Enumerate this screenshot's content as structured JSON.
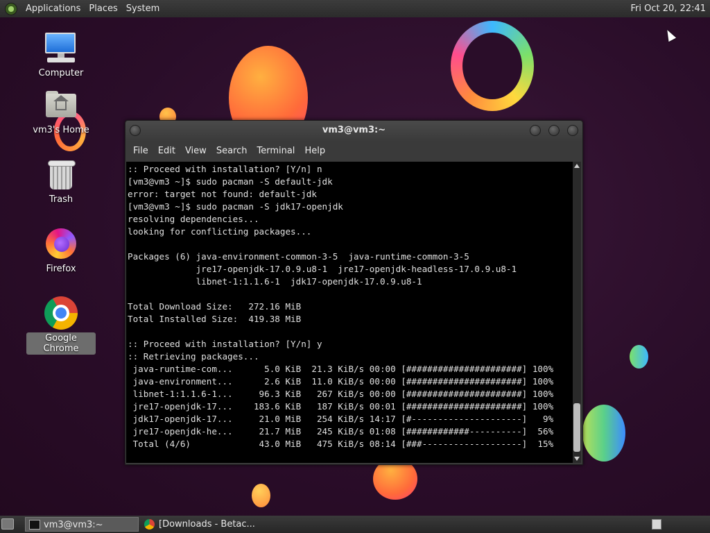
{
  "top_panel": {
    "menus": [
      "Applications",
      "Places",
      "System"
    ],
    "clock": "Fri Oct 20, 22:41"
  },
  "desktop_icons": [
    {
      "label": "Computer",
      "icon": "computer-icon"
    },
    {
      "label": "vm3's Home",
      "icon": "home-folder-icon"
    },
    {
      "label": "Trash",
      "icon": "trash-icon"
    },
    {
      "label": "Firefox",
      "icon": "firefox-icon"
    },
    {
      "label": "Google Chrome",
      "icon": "chrome-icon",
      "selected": true
    }
  ],
  "terminal": {
    "title": "vm3@vm3:~",
    "menus": [
      "File",
      "Edit",
      "View",
      "Search",
      "Terminal",
      "Help"
    ],
    "lines": [
      ":: Proceed with installation? [Y/n] n",
      "[vm3@vm3 ~]$ sudo pacman -S default-jdk",
      "error: target not found: default-jdk",
      "[vm3@vm3 ~]$ sudo pacman -S jdk17-openjdk",
      "resolving dependencies...",
      "looking for conflicting packages...",
      "",
      "Packages (6) java-environment-common-3-5  java-runtime-common-3-5",
      "             jre17-openjdk-17.0.9.u8-1  jre17-openjdk-headless-17.0.9.u8-1",
      "             libnet-1:1.1.6-1  jdk17-openjdk-17.0.9.u8-1",
      "",
      "Total Download Size:   272.16 MiB",
      "Total Installed Size:  419.38 MiB",
      "",
      ":: Proceed with installation? [Y/n] y",
      ":: Retrieving packages...",
      " java-runtime-com...      5.0 KiB  21.3 KiB/s 00:00 [######################] 100%",
      " java-environment...      2.6 KiB  11.0 KiB/s 00:00 [######################] 100%",
      " libnet-1:1.1.6-1...     96.3 KiB   267 KiB/s 00:00 [######################] 100%",
      " jre17-openjdk-17...    183.6 KiB   187 KiB/s 00:01 [######################] 100%",
      " jdk17-openjdk-17...     21.0 MiB   254 KiB/s 14:17 [#---------------------]   9%",
      " jre17-openjdk-he...     21.7 MiB   245 KiB/s 01:08 [############----------]  56%",
      " Total (4/6)             43.0 MiB   475 KiB/s 08:14 [###-------------------]  15%"
    ]
  },
  "taskbar": {
    "tasks": [
      {
        "label": "vm3@vm3:~",
        "icon": "terminal-icon",
        "active": true
      },
      {
        "label": "[Downloads - Betac...",
        "icon": "chrome-icon",
        "active": false
      }
    ]
  }
}
